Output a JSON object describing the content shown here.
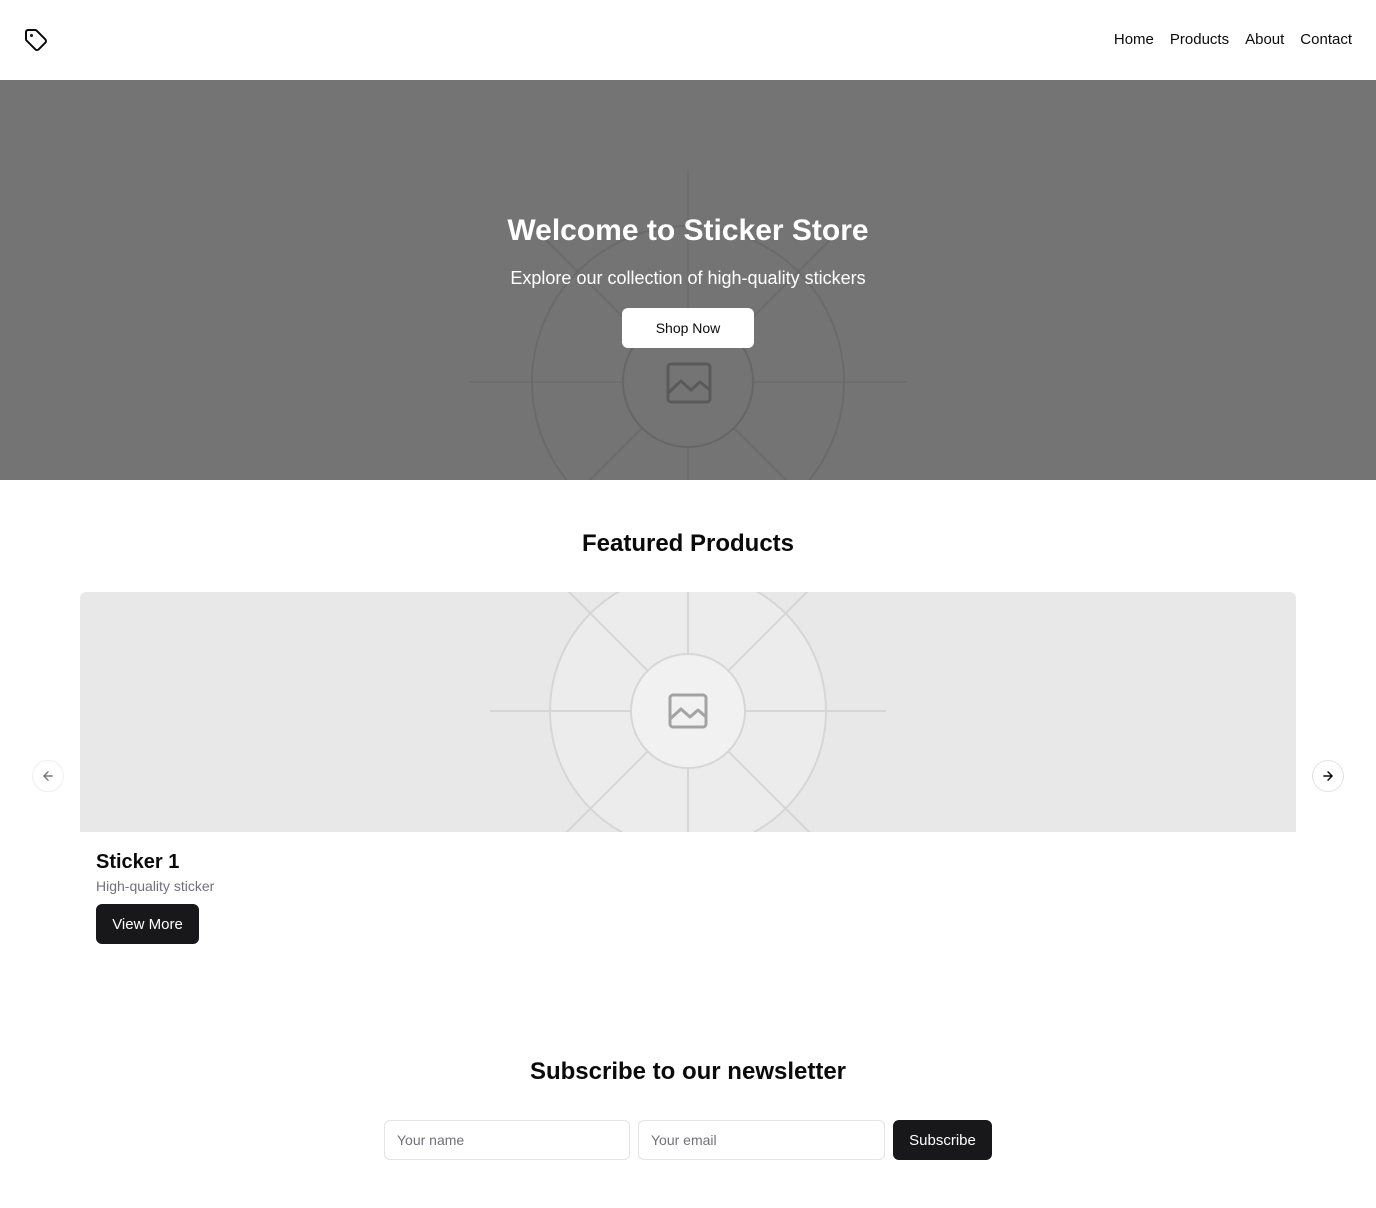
{
  "header": {
    "logo_icon": "tag-icon",
    "nav": [
      {
        "label": "Home"
      },
      {
        "label": "Products"
      },
      {
        "label": "About"
      },
      {
        "label": "Contact"
      }
    ]
  },
  "hero": {
    "title": "Welcome to Sticker Store",
    "subtitle": "Explore our collection of high-quality stickers",
    "cta_label": "Shop Now",
    "background_color": "#747474",
    "placeholder_icon": "image-placeholder-icon"
  },
  "featured": {
    "title": "Featured Products",
    "prev_icon": "arrow-left-icon",
    "next_icon": "arrow-right-icon",
    "products": [
      {
        "name": "Sticker 1",
        "description": "High-quality sticker",
        "button_label": "View More",
        "image_icon": "image-placeholder-icon"
      }
    ]
  },
  "newsletter": {
    "title": "Subscribe to our newsletter",
    "name_placeholder": "Your name",
    "email_placeholder": "Your email",
    "submit_label": "Subscribe"
  },
  "colors": {
    "primary_button": "#18181b",
    "muted_text": "#71717a",
    "border": "#e4e4e7"
  }
}
